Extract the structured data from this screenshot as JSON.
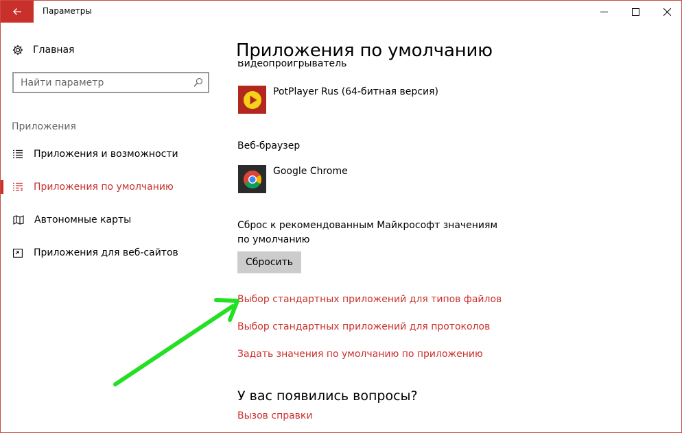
{
  "window": {
    "title": "Параметры",
    "accent": "#c9302c"
  },
  "sidebar": {
    "home_label": "Главная",
    "search_placeholder": "Найти параметр",
    "section_label": "Приложения",
    "items": [
      {
        "label": "Приложения и возможности",
        "icon": "list-icon",
        "active": false
      },
      {
        "label": "Приложения по умолчанию",
        "icon": "default-apps-icon",
        "active": true
      },
      {
        "label": "Автономные карты",
        "icon": "map-icon",
        "active": false
      },
      {
        "label": "Приложения для веб-сайтов",
        "icon": "web-apps-icon",
        "active": false
      }
    ]
  },
  "main": {
    "title": "Приложения по умолчанию",
    "video_player_label": "Видеопроигрыватель",
    "video_player_app": "PotPlayer Rus (64-битная версия)",
    "browser_label": "Веб-браузер",
    "browser_app": "Google Chrome",
    "reset_text": "Сброс к рекомендованным Майкрософт значениям по умолчанию",
    "reset_button": "Сбросить",
    "links": [
      "Выбор стандартных приложений для типов файлов",
      "Выбор стандартных приложений для протоколов",
      "Задать значения по умолчанию по приложению"
    ],
    "questions_heading": "У вас появились вопросы?",
    "help_link": "Вызов справки"
  },
  "annotation": {
    "arrow_color": "#22e022"
  }
}
